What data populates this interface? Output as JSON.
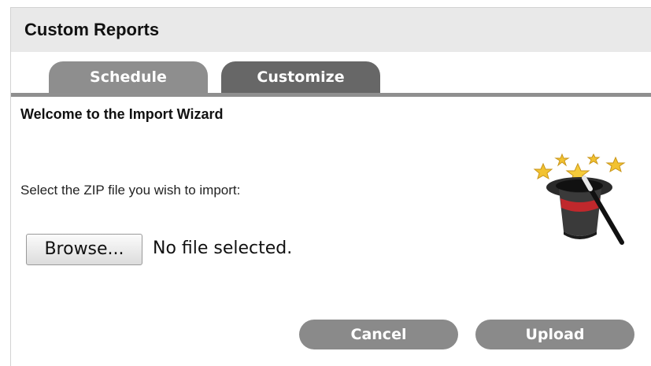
{
  "header": {
    "title": "Custom Reports"
  },
  "tabs": [
    {
      "label": "Schedule"
    },
    {
      "label": "Customize"
    }
  ],
  "wizard": {
    "title": "Welcome to the Import Wizard",
    "prompt": "Select the ZIP file you wish to import:",
    "browse_label": "Browse...",
    "file_status": "No file selected.",
    "icon": "magic-hat-icon"
  },
  "actions": {
    "cancel_label": "Cancel",
    "upload_label": "Upload"
  },
  "colors": {
    "header_bg": "#e9e9e9",
    "tab_inactive": "#8e8e8e",
    "tab_active": "#676767",
    "button_bg": "#8a8a8a"
  }
}
